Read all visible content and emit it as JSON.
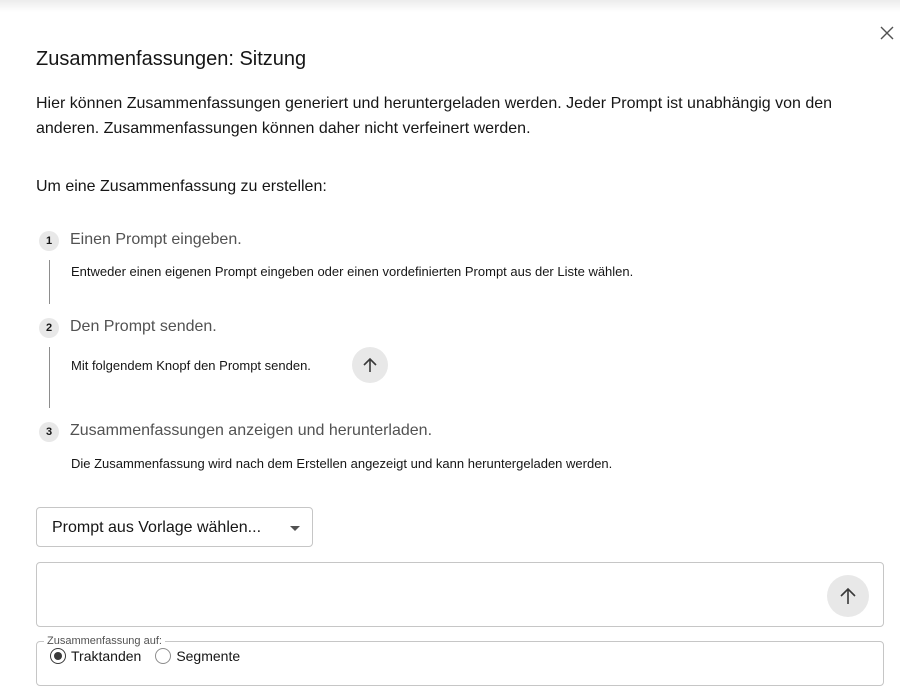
{
  "dialog": {
    "title": "Zusammenfassungen: Sitzung",
    "intro": "Hier können Zusammenfassungen generiert und heruntergeladen werden. Jeder Prompt ist unabhängig von den anderen. Zusammenfassungen können daher nicht verfeinert werden.",
    "howto_heading": "Um eine Zusammenfassung zu erstellen:",
    "close_icon": "close-icon"
  },
  "steps": [
    {
      "number": "1",
      "title": "Einen Prompt eingeben.",
      "description": "Entweder einen eigenen Prompt eingeben oder einen vordefinierten Prompt aus der Liste wählen."
    },
    {
      "number": "2",
      "title": "Den Prompt senden.",
      "description": "Mit folgendem Knopf den Prompt senden.",
      "icon": "arrow-up-icon"
    },
    {
      "number": "3",
      "title": "Zusammenfassungen anzeigen und herunterladen.",
      "description": "Die Zusammenfassung wird nach dem Erstellen angezeigt und kann heruntergeladen werden."
    }
  ],
  "template_select": {
    "label": "Prompt aus Vorlage wählen..."
  },
  "prompt": {
    "value": "",
    "send_icon": "arrow-up-icon"
  },
  "summary_target": {
    "legend": "Zusammenfassung auf:",
    "options": [
      {
        "label": "Traktanden",
        "selected": true
      },
      {
        "label": "Segmente",
        "selected": false
      }
    ]
  },
  "colors": {
    "text": "#161616",
    "muted": "#525252",
    "border": "#c6c6c6",
    "icon_button_bg": "#e8e8e8"
  }
}
